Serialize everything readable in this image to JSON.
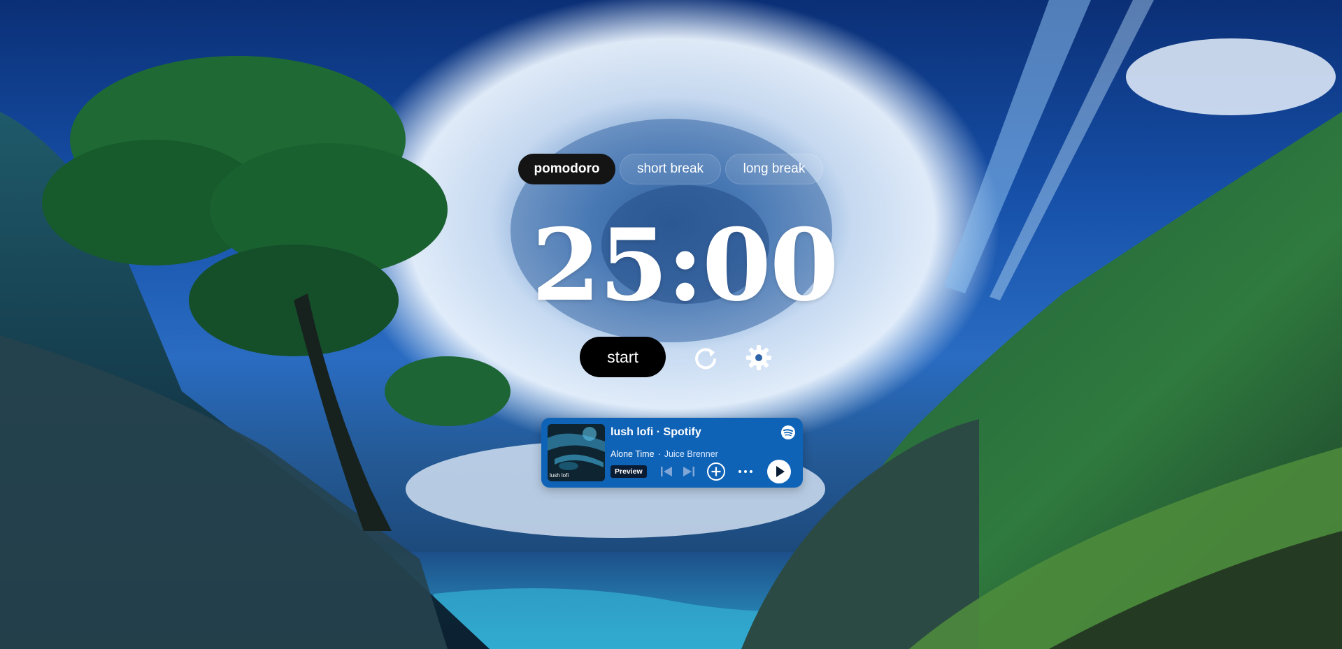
{
  "modes": {
    "pomodoro": "pomodoro",
    "short_break": "short break",
    "long_break": "long break",
    "active": "pomodoro"
  },
  "timer": {
    "display": "25:00"
  },
  "controls": {
    "start_label": "start",
    "reset_icon": "reset-icon",
    "settings_icon": "gear-icon"
  },
  "spotify": {
    "playlist_title": "lush lofi · Spotify",
    "track": "Alone Time",
    "artist": "Juice Brenner",
    "badge": "Preview",
    "album_caption": "lush lofi",
    "widget_color": "#0f63b7"
  },
  "colors": {
    "active_tab": "#141414",
    "start_button": "#000000",
    "timer_text": "#ffffff"
  }
}
